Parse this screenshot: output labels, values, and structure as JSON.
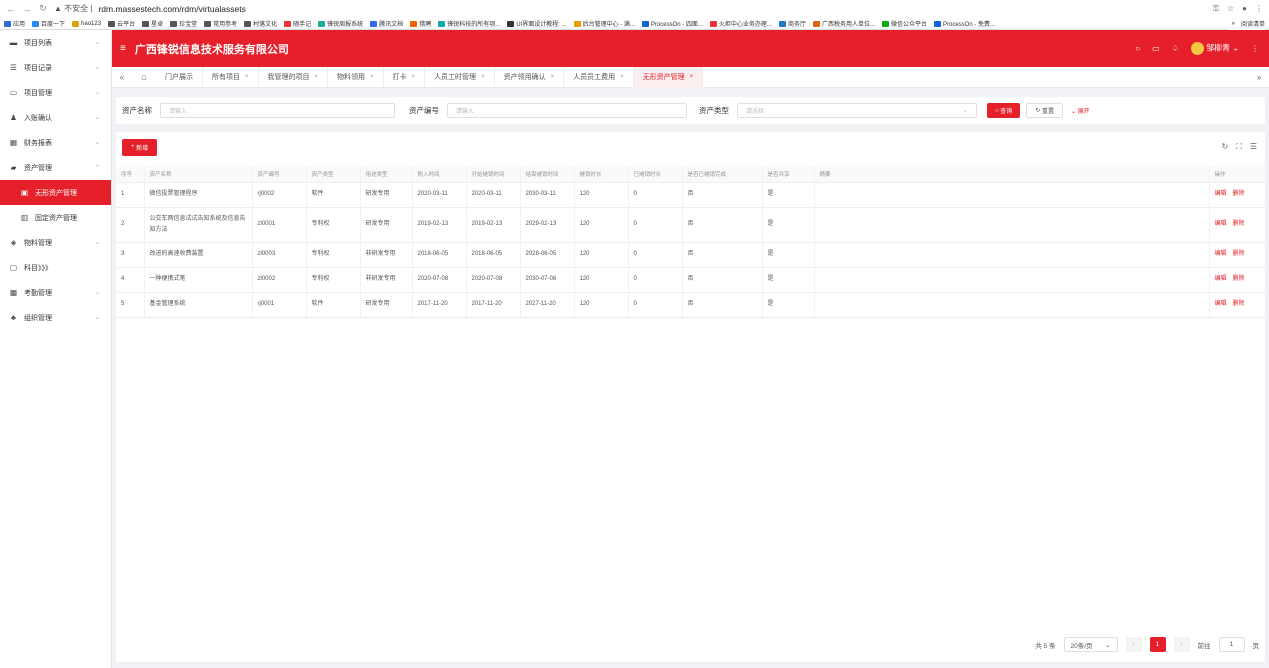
{
  "browser": {
    "security": "不安全",
    "url": "rdm.massestech.com/rdm/virtualassets",
    "bookmarks": [
      "应用",
      "百度一下",
      "hao123",
      "云平台",
      "星卓",
      "珍宝堂",
      "常用参考",
      "村落文化",
      "随手记",
      "锋锐周报系统",
      "腾讯文档",
      "猎聘",
      "锋锐科技的所有项...",
      "UI界面设计教程: ...",
      "后台管理中心 - 满...",
      "ProcessOn - 四面...",
      "火炬中心业务办理...",
      "商务厅",
      "广西税务用人单位...",
      "微信公众平台",
      "ProcessOn - 免费..."
    ],
    "reading_list": "阅读清单"
  },
  "sidebar": {
    "items": [
      {
        "label": "项目列表",
        "icon": "folder-icon",
        "caret": "⌄"
      },
      {
        "label": "项目记录",
        "icon": "list-icon",
        "caret": "⌄"
      },
      {
        "label": "项目管理",
        "icon": "monitor-icon",
        "caret": "⌄"
      },
      {
        "label": "入账确认",
        "icon": "person-icon",
        "caret": "⌄"
      },
      {
        "label": "财务报表",
        "icon": "calendar-icon",
        "caret": "⌄"
      },
      {
        "label": "资产管理",
        "icon": "briefcase-icon",
        "caret": "⌃"
      },
      {
        "label": "无形资产管理",
        "icon": "grid-icon",
        "caret": "",
        "sub": true,
        "active": true
      },
      {
        "label": "固定资产管理",
        "icon": "building-icon",
        "caret": "",
        "sub": true
      },
      {
        "label": "物料管理",
        "icon": "layers-icon",
        "caret": "⌄"
      },
      {
        "label": "科目》》》",
        "icon": "window-icon",
        "caret": ""
      },
      {
        "label": "考勤管理",
        "icon": "calculator-icon",
        "caret": "⌄"
      },
      {
        "label": "组织管理",
        "icon": "group-icon",
        "caret": "⌄"
      }
    ]
  },
  "header": {
    "title": "广西锋锐信息技术服务有限公司",
    "user": "邹柳青"
  },
  "tabs": [
    {
      "label": "门户展示",
      "close": false
    },
    {
      "label": "所有项目",
      "close": true
    },
    {
      "label": "我管理的项目",
      "close": true
    },
    {
      "label": "物料领用",
      "close": true
    },
    {
      "label": "打卡",
      "close": true
    },
    {
      "label": "人员工时管理",
      "close": true
    },
    {
      "label": "资产领用确认",
      "close": true
    },
    {
      "label": "人员员工费用",
      "close": true
    },
    {
      "label": "无形资产管理",
      "close": true,
      "active": true
    }
  ],
  "filter": {
    "name_label": "资产名称",
    "name_placeholder": "请输入",
    "code_label": "资产编号",
    "code_placeholder": "请输入",
    "type_label": "资产类型",
    "type_placeholder": "请选择",
    "search": "查询",
    "reset": "重置",
    "expand": "展开"
  },
  "toolbar": {
    "add": "新增"
  },
  "table": {
    "columns": [
      "序号",
      "资产名称",
      "资产编号",
      "资产类型",
      "用途类型",
      "购入时间",
      "开始摊销时间",
      "结束摊销时间",
      "摊销时长",
      "已摊销时长",
      "是否已摊销完成",
      "是否共享",
      "摘要",
      "操作"
    ],
    "rows": [
      [
        "1",
        "微信投票管理程序",
        "rj0002",
        "软件",
        "研发专用",
        "2020-03-11",
        "2020-03-11",
        "2030-03-11",
        "120",
        "0",
        "否",
        "是",
        ""
      ],
      [
        "2",
        "公交车两信息试试告知系统及信息告知方法",
        "zl0001",
        "专利权",
        "研发专用",
        "2019-02-13",
        "2019-02-13",
        "2029-02-13",
        "120",
        "0",
        "否",
        "是",
        ""
      ],
      [
        "3",
        "改进的高速收费装置",
        "zl0003",
        "专利权",
        "非研发专用",
        "2018-06-05",
        "2018-06-05",
        "2028-06-05",
        "120",
        "0",
        "否",
        "是",
        ""
      ],
      [
        "4",
        "一种便携式笔",
        "zl0002",
        "专利权",
        "非研发专用",
        "2020-07-08",
        "2020-07-08",
        "2030-07-08",
        "120",
        "0",
        "否",
        "是",
        ""
      ],
      [
        "5",
        "基金管理系统",
        "rj0001",
        "软件",
        "研发专用",
        "2017-11-20",
        "2017-11-20",
        "2027-11-20",
        "120",
        "0",
        "否",
        "是",
        ""
      ]
    ],
    "edit": "编辑",
    "delete": "删除"
  },
  "pager": {
    "total": "共 5 条",
    "page_size": "20条/页",
    "current": "1",
    "goto": "前往",
    "goto_value": "1",
    "page_unit": "页"
  },
  "colors": {
    "accent": "#e5202a"
  }
}
